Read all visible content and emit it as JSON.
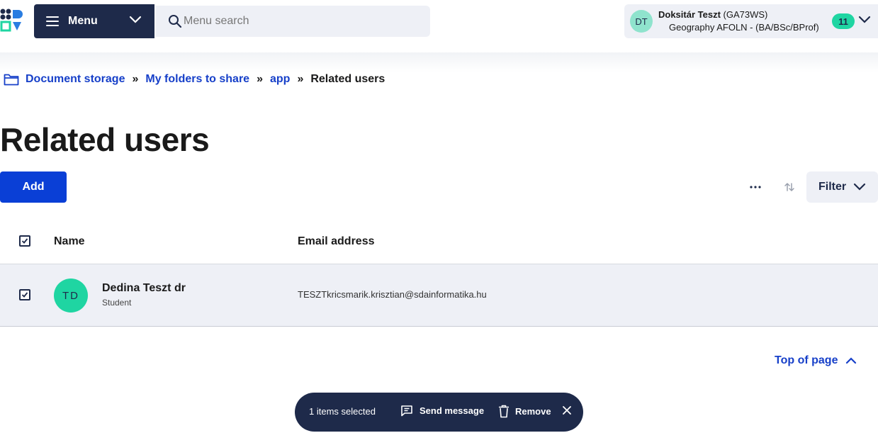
{
  "header": {
    "menu_label": "Menu",
    "search_placeholder": "Menu search",
    "user": {
      "initials": "DT",
      "name": "Doksitár Teszt",
      "code": "(GA73WS)",
      "program": "Geography AFOLN - (BA/BSc/BProf)",
      "notification_count": "11"
    }
  },
  "breadcrumb": {
    "items": [
      "Document storage",
      "My folders to share",
      "app"
    ],
    "separator": "»",
    "current": "Related users"
  },
  "page_title": "Related users",
  "toolbar": {
    "add_label": "Add",
    "more_label": "···",
    "filter_label": "Filter"
  },
  "table": {
    "headers": {
      "name": "Name",
      "email": "Email address"
    },
    "rows": [
      {
        "initials": "TD",
        "name": "Dedina Teszt dr",
        "role": "Student",
        "email": "TESZTkricsmarik.krisztian@sdainformatika.hu",
        "checked": true
      }
    ]
  },
  "footer": {
    "top_of_page": "Top of page"
  },
  "action_bar": {
    "selected_text": "1 items selected",
    "send_message": "Send message",
    "remove": "Remove"
  },
  "colors": {
    "navy": "#1e2a4a",
    "primary": "#0a3fd6",
    "link": "#1740c9",
    "accent_green": "#1fd5a2",
    "surface": "#eef0f6"
  }
}
